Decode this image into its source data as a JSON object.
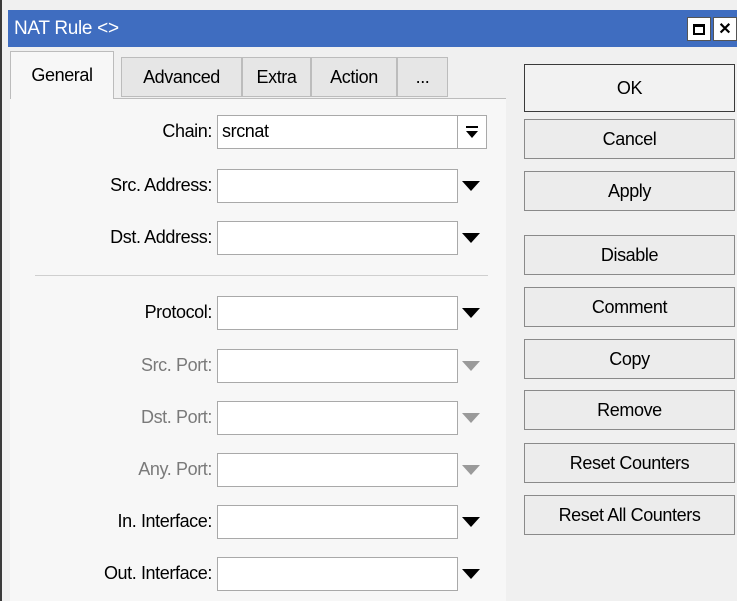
{
  "window": {
    "title": "NAT Rule <>",
    "title_color": "#3f6dc0"
  },
  "tabs": [
    {
      "label": "General",
      "active": true
    },
    {
      "label": "Advanced",
      "active": false
    },
    {
      "label": "Extra",
      "active": false
    },
    {
      "label": "Action",
      "active": false
    },
    {
      "label": "...",
      "active": false
    }
  ],
  "fields": {
    "chain": {
      "label": "Chain:",
      "value": "srcnat"
    },
    "src_address": {
      "label": "Src. Address:",
      "value": ""
    },
    "dst_address": {
      "label": "Dst. Address:",
      "value": ""
    },
    "protocol": {
      "label": "Protocol:",
      "value": ""
    },
    "src_port": {
      "label": "Src. Port:",
      "value": ""
    },
    "dst_port": {
      "label": "Dst. Port:",
      "value": ""
    },
    "any_port": {
      "label": "Any. Port:",
      "value": ""
    },
    "in_interface": {
      "label": "In. Interface:",
      "value": ""
    },
    "out_interface": {
      "label": "Out. Interface:",
      "value": ""
    }
  },
  "buttons": {
    "ok": "OK",
    "cancel": "Cancel",
    "apply": "Apply",
    "disable": "Disable",
    "comment": "Comment",
    "copy": "Copy",
    "remove": "Remove",
    "reset_counters": "Reset Counters",
    "reset_all_counters": "Reset All Counters"
  }
}
